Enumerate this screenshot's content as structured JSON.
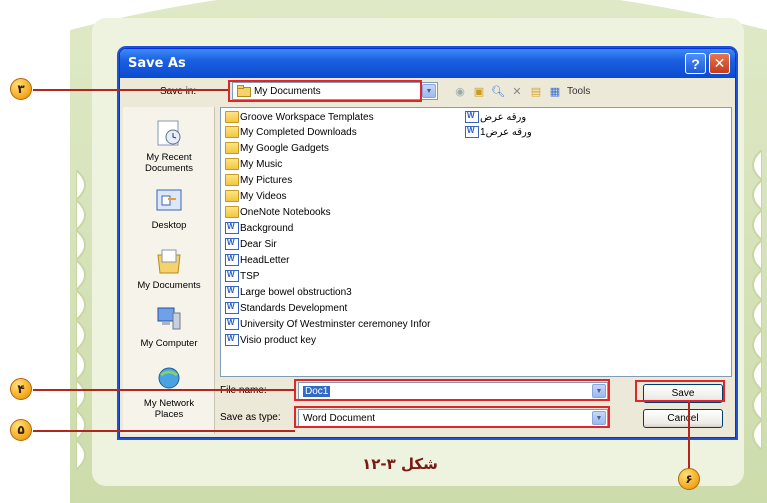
{
  "dialog": {
    "title": "Save As",
    "help_label": "?",
    "close_label": "✕"
  },
  "save_in": {
    "label": "Save in:",
    "value": "My Documents",
    "tools_label": "Tools"
  },
  "places": [
    {
      "label_line1": "My Recent",
      "label_line2": "Documents",
      "icon": "recent-documents-icon"
    },
    {
      "label_line1": "Desktop",
      "label_line2": "",
      "icon": "desktop-icon"
    },
    {
      "label_line1": "My Documents",
      "label_line2": "",
      "icon": "my-documents-icon"
    },
    {
      "label_line1": "My Computer",
      "label_line2": "",
      "icon": "my-computer-icon"
    },
    {
      "label_line1": "My Network",
      "label_line2": "Places",
      "icon": "network-places-icon"
    }
  ],
  "files_col1": [
    {
      "name": "Groove Workspace Templates",
      "type": "folder"
    },
    {
      "name": "My Completed Downloads",
      "type": "folder"
    },
    {
      "name": "My Google Gadgets",
      "type": "folder"
    },
    {
      "name": "My Music",
      "type": "folder"
    },
    {
      "name": "My Pictures",
      "type": "folder"
    },
    {
      "name": "My Videos",
      "type": "folder"
    },
    {
      "name": "OneNote Notebooks",
      "type": "folder"
    },
    {
      "name": "Background",
      "type": "doc"
    },
    {
      "name": "Dear Sir",
      "type": "doc"
    },
    {
      "name": "HeadLetter",
      "type": "doc"
    },
    {
      "name": "TSP",
      "type": "doc"
    },
    {
      "name": "Large bowel obstruction3",
      "type": "doc"
    },
    {
      "name": "Standards Development",
      "type": "doc"
    },
    {
      "name": "University Of Westminster ceremoney Infor",
      "type": "doc"
    },
    {
      "name": "Visio product key",
      "type": "doc"
    }
  ],
  "files_col2": [
    {
      "name": "ورقه عرض",
      "type": "doc"
    },
    {
      "name": "ورقه عرض1",
      "type": "doc"
    }
  ],
  "file_name": {
    "label": "File name:",
    "value": "Doc1"
  },
  "save_type": {
    "label": "Save as type:",
    "value": "Word Document"
  },
  "buttons": {
    "save": "Save",
    "cancel": "Cancel"
  },
  "callouts": {
    "n3": "٣",
    "n4": "۴",
    "n5": "۵",
    "n6": "۶"
  },
  "caption": "شکل ٣-١٢",
  "colors": {
    "highlight": "#e0252b",
    "titlebar": "#1c5fe0",
    "frame": "#cddcab"
  }
}
